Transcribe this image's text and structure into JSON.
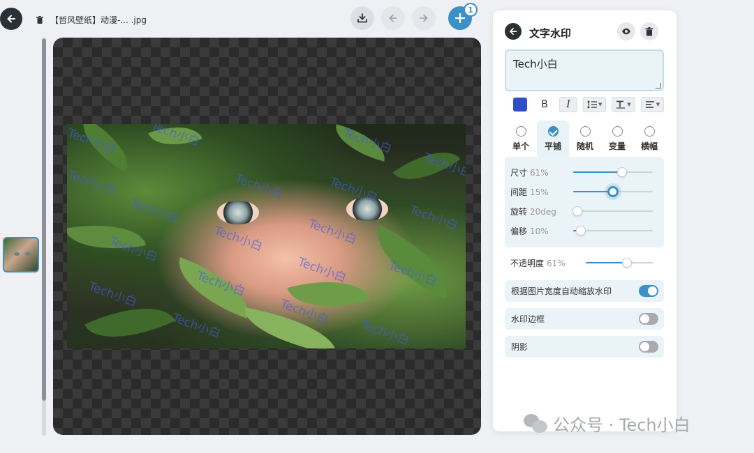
{
  "header": {
    "file_name": "【哲风壁纸】动漫-...  .jpg",
    "add_badge": "1"
  },
  "canvas": {
    "watermark_text": "Tech小白"
  },
  "panel": {
    "title": "文字水印",
    "text_value": "Tech小白",
    "format": {
      "color": "#2f4fc8",
      "bold_label": "B",
      "italic_label": "I"
    },
    "modes": [
      {
        "label": "单个",
        "checked": false
      },
      {
        "label": "平铺",
        "checked": true
      },
      {
        "label": "随机",
        "checked": false
      },
      {
        "label": "变量",
        "checked": false
      },
      {
        "label": "横幅",
        "checked": false
      }
    ],
    "sliders": [
      {
        "label": "尺寸",
        "value": "61%",
        "fraction": 0.61
      },
      {
        "label": "间距",
        "value": "15%",
        "fraction": 0.5
      },
      {
        "label": "旋转",
        "value": "20deg",
        "fraction": 0.05
      },
      {
        "label": "偏移",
        "value": "10%",
        "fraction": 0.1
      }
    ],
    "opacity": {
      "label": "不透明度",
      "value": "61%",
      "fraction": 0.61
    },
    "toggles": [
      {
        "label": "根据图片宽度自动缩放水印",
        "on": true
      },
      {
        "label": "水印边框",
        "on": false
      },
      {
        "label": "阴影",
        "on": false
      }
    ]
  },
  "footer": {
    "text": "公众号 · Tech小白"
  }
}
